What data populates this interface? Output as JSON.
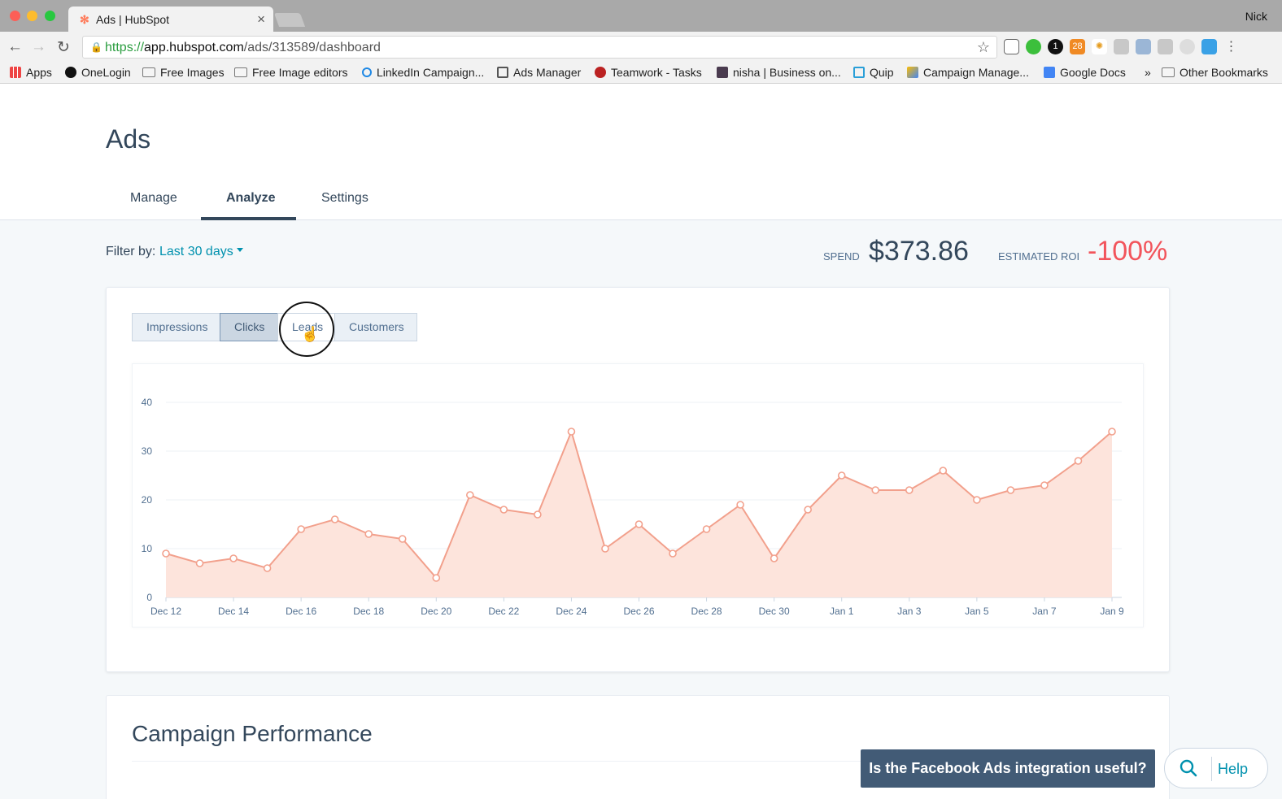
{
  "browser": {
    "tab_title": "Ads | HubSpot",
    "tab_close": "×",
    "user": "Nick",
    "url_scheme": "https://",
    "url_host": "app.hubspot.com",
    "url_path": "/ads/313589/dashboard",
    "bookmarks": [
      {
        "label": "Apps"
      },
      {
        "label": "OneLogin"
      },
      {
        "label": "Free Images"
      },
      {
        "label": "Free Image editors"
      },
      {
        "label": "LinkedIn Campaign..."
      },
      {
        "label": "Ads Manager"
      },
      {
        "label": "Teamwork - Tasks"
      },
      {
        "label": "nisha | Business on..."
      },
      {
        "label": "Quip"
      },
      {
        "label": "Campaign Manage..."
      },
      {
        "label": "Google Docs"
      },
      {
        "label": "»"
      },
      {
        "label": "Other Bookmarks"
      }
    ],
    "calendar_badge": "28"
  },
  "page": {
    "title": "Ads",
    "tabs": [
      {
        "label": "Manage"
      },
      {
        "label": "Analyze",
        "active": true
      },
      {
        "label": "Settings"
      }
    ]
  },
  "filter": {
    "label": "Filter by:",
    "value": "Last 30 days"
  },
  "stats": {
    "spend_label": "SPEND",
    "spend_value": "$373.86",
    "roi_label": "ESTIMATED ROI",
    "roi_value": "-100%",
    "roi_color": "#f2545b"
  },
  "metric_tabs": [
    {
      "label": "Impressions"
    },
    {
      "label": "Clicks",
      "active": true
    },
    {
      "label": "Leads"
    },
    {
      "label": "Customers"
    }
  ],
  "chart_data": {
    "type": "area",
    "x_labels": [
      "Dec 12",
      "Dec 14",
      "Dec 16",
      "Dec 18",
      "Dec 20",
      "Dec 22",
      "Dec 24",
      "Dec 26",
      "Dec 28",
      "Dec 30",
      "Jan 1",
      "Jan 3",
      "Jan 5",
      "Jan 7",
      "Jan 9"
    ],
    "dates": [
      "Dec 12",
      "Dec 13",
      "Dec 14",
      "Dec 15",
      "Dec 16",
      "Dec 17",
      "Dec 18",
      "Dec 19",
      "Dec 20",
      "Dec 21",
      "Dec 22",
      "Dec 23",
      "Dec 24",
      "Dec 25",
      "Dec 26",
      "Dec 27",
      "Dec 28",
      "Dec 29",
      "Dec 30",
      "Dec 31",
      "Jan 1",
      "Jan 2",
      "Jan 3",
      "Jan 4",
      "Jan 5",
      "Jan 6",
      "Jan 7",
      "Jan 8",
      "Jan 9"
    ],
    "series": [
      {
        "values": [
          9,
          7,
          8,
          6,
          14,
          16,
          13,
          12,
          4,
          21,
          18,
          17,
          34,
          10,
          15,
          9,
          14,
          19,
          8,
          18,
          25,
          22,
          22,
          26,
          20,
          22,
          23,
          28,
          34
        ]
      }
    ],
    "y_ticks": [
      0,
      10,
      20,
      30,
      40
    ],
    "ylim": [
      0,
      40
    ],
    "grid": true,
    "line_color": "#f2a08c",
    "fill_color": "#fde4dc"
  },
  "campaign": {
    "title": "Campaign Performance"
  },
  "feedback": {
    "text": "Is the Facebook Ads integration useful?"
  },
  "help": {
    "label": "Help"
  }
}
